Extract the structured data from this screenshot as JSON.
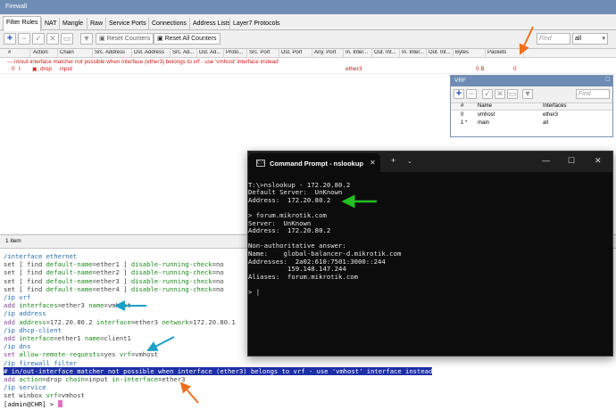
{
  "firewall": {
    "title": "Firewall",
    "tabs": [
      "Filter Rules",
      "NAT",
      "Mangle",
      "Raw",
      "Service Ports",
      "Connections",
      "Address Lists",
      "Layer7 Protocols"
    ],
    "toolbar": {
      "reset_counters": "Reset Counters",
      "reset_all_counters": "Reset All Counters",
      "find_placeholder": "Find",
      "filter_value": "all"
    },
    "columns": [
      "#",
      "Action",
      "Chain",
      "Src. Address",
      "Dst. Address",
      "Src. Ad...",
      "Dst. Ad...",
      "Proto...",
      "Src. Port",
      "Dst. Port",
      "Any. Port",
      "In. Inter...",
      "Out. Int...",
      "In. Inter...",
      "Out. Int...",
      "Bytes",
      "Packets"
    ],
    "rule": {
      "comment": "--- in/out-interface matcher not possible when interface (ether3) belongs to vrf - use 'vmhost' interface instead",
      "number": "0",
      "flag": "I",
      "action_icon": "x-icon",
      "action": "drop",
      "chain": "input",
      "in_interface": "ether3",
      "bytes": "0 B",
      "packets": "0"
    },
    "status": "1 item"
  },
  "vrf": {
    "title": "VRF",
    "find_placeholder": "Find",
    "columns": [
      "#",
      "Name",
      "Interfaces"
    ],
    "rows": [
      {
        "num": "0",
        "name": "vmhost",
        "interfaces": "ether3"
      },
      {
        "num": "1 *",
        "name": "main",
        "interfaces": "all"
      }
    ]
  },
  "terminal": {
    "lines": [
      {
        "parts": [
          {
            "t": "/interface ethernet",
            "c": "c-blue"
          }
        ]
      },
      {
        "parts": [
          {
            "t": "set [ find ",
            "c": "c-gray"
          },
          {
            "t": "default-name",
            "c": "c-green"
          },
          {
            "t": "=ether1 ] ",
            "c": "c-gray"
          },
          {
            "t": "disable-running-check",
            "c": "c-green"
          },
          {
            "t": "=no",
            "c": "c-gray"
          }
        ]
      },
      {
        "parts": [
          {
            "t": "set [ find ",
            "c": "c-gray"
          },
          {
            "t": "default-name",
            "c": "c-green"
          },
          {
            "t": "=ether2 ] ",
            "c": "c-gray"
          },
          {
            "t": "disable-running-check",
            "c": "c-green"
          },
          {
            "t": "=no",
            "c": "c-gray"
          }
        ]
      },
      {
        "parts": [
          {
            "t": "set [ find ",
            "c": "c-gray"
          },
          {
            "t": "default-name",
            "c": "c-green"
          },
          {
            "t": "=ether3 ] ",
            "c": "c-gray"
          },
          {
            "t": "disable-running-check",
            "c": "c-green"
          },
          {
            "t": "=no",
            "c": "c-gray"
          }
        ]
      },
      {
        "parts": [
          {
            "t": "set [ find ",
            "c": "c-gray"
          },
          {
            "t": "default-name",
            "c": "c-green"
          },
          {
            "t": "=ether4 ] ",
            "c": "c-gray"
          },
          {
            "t": "disable-running-check",
            "c": "c-green"
          },
          {
            "t": "=no",
            "c": "c-gray"
          }
        ]
      },
      {
        "parts": [
          {
            "t": "/ip vrf",
            "c": "c-blue"
          }
        ]
      },
      {
        "parts": [
          {
            "t": "add ",
            "c": "c-purple"
          },
          {
            "t": "interfaces",
            "c": "c-green"
          },
          {
            "t": "=ether3 ",
            "c": "c-gray"
          },
          {
            "t": "name",
            "c": "c-green"
          },
          {
            "t": "=vmhost",
            "c": "c-gray"
          }
        ]
      },
      {
        "parts": [
          {
            "t": "/ip address",
            "c": "c-blue"
          }
        ]
      },
      {
        "parts": [
          {
            "t": "add ",
            "c": "c-purple"
          },
          {
            "t": "address",
            "c": "c-green"
          },
          {
            "t": "=172.20.80.2 ",
            "c": "c-gray"
          },
          {
            "t": "interface",
            "c": "c-green"
          },
          {
            "t": "=ether3 ",
            "c": "c-gray"
          },
          {
            "t": "network",
            "c": "c-green"
          },
          {
            "t": "=172.20.80.1",
            "c": "c-gray"
          }
        ]
      },
      {
        "parts": [
          {
            "t": "/ip dhcp-client",
            "c": "c-blue"
          }
        ]
      },
      {
        "parts": [
          {
            "t": "add ",
            "c": "c-purple"
          },
          {
            "t": "interface",
            "c": "c-green"
          },
          {
            "t": "=ether1 ",
            "c": "c-gray"
          },
          {
            "t": "name",
            "c": "c-green"
          },
          {
            "t": "=client1",
            "c": "c-gray"
          }
        ]
      },
      {
        "parts": [
          {
            "t": "/ip dns",
            "c": "c-blue"
          }
        ]
      },
      {
        "parts": [
          {
            "t": "set ",
            "c": "c-purple"
          },
          {
            "t": "allow-remote-requests",
            "c": "c-green"
          },
          {
            "t": "=yes ",
            "c": "c-gray"
          },
          {
            "t": "vrf",
            "c": "c-green"
          },
          {
            "t": "=vmhost",
            "c": "c-gray"
          }
        ]
      },
      {
        "parts": [
          {
            "t": "/ip firewall filter",
            "c": "c-blue"
          }
        ]
      },
      {
        "parts": [
          {
            "t": "# in/out-interface matcher not possible when interface (ether3) belongs to vrf - use 'vmhost' interface instead",
            "c": "hl"
          }
        ]
      },
      {
        "parts": [
          {
            "t": "add ",
            "c": "c-purple"
          },
          {
            "t": "action",
            "c": "c-green"
          },
          {
            "t": "=drop ",
            "c": "c-gray"
          },
          {
            "t": "chain",
            "c": "c-green"
          },
          {
            "t": "=input ",
            "c": "c-gray"
          },
          {
            "t": "in-interface",
            "c": "c-green"
          },
          {
            "t": "=ether3",
            "c": "c-gray"
          }
        ]
      },
      {
        "parts": [
          {
            "t": "/ip service",
            "c": "c-blue"
          }
        ]
      },
      {
        "parts": [
          {
            "t": "set winbox ",
            "c": "c-gray"
          },
          {
            "t": "vrf",
            "c": "c-green"
          },
          {
            "t": "=vmhost",
            "c": "c-gray"
          }
        ]
      },
      {
        "parts": [
          {
            "t": "[admin@CHR] > ",
            "c": "c-black"
          }
        ]
      }
    ]
  },
  "cmd": {
    "title": "Command Prompt - nslookup",
    "icon_label": "C:\\",
    "lines": [
      "",
      "T:\\>nslookup - 172.20.80.2",
      "Default Server:  UnKnown",
      "Address:  172.20.80.2",
      "",
      "> forum.mikrotik.com",
      "Server:  UnKnown",
      "Address:  172.20.80.2",
      "",
      "Non-authoritative answer:",
      "Name:    global-balancer-d.mikrotik.com",
      "Addresses:  2a02:610:7501:3000::244",
      "          159.148.147.244",
      "Aliases:  forum.mikrotik.com",
      "",
      "> |"
    ]
  },
  "annotations": {
    "orange": "#f07020",
    "green": "#22c022",
    "teal": "#1e9ec8"
  }
}
